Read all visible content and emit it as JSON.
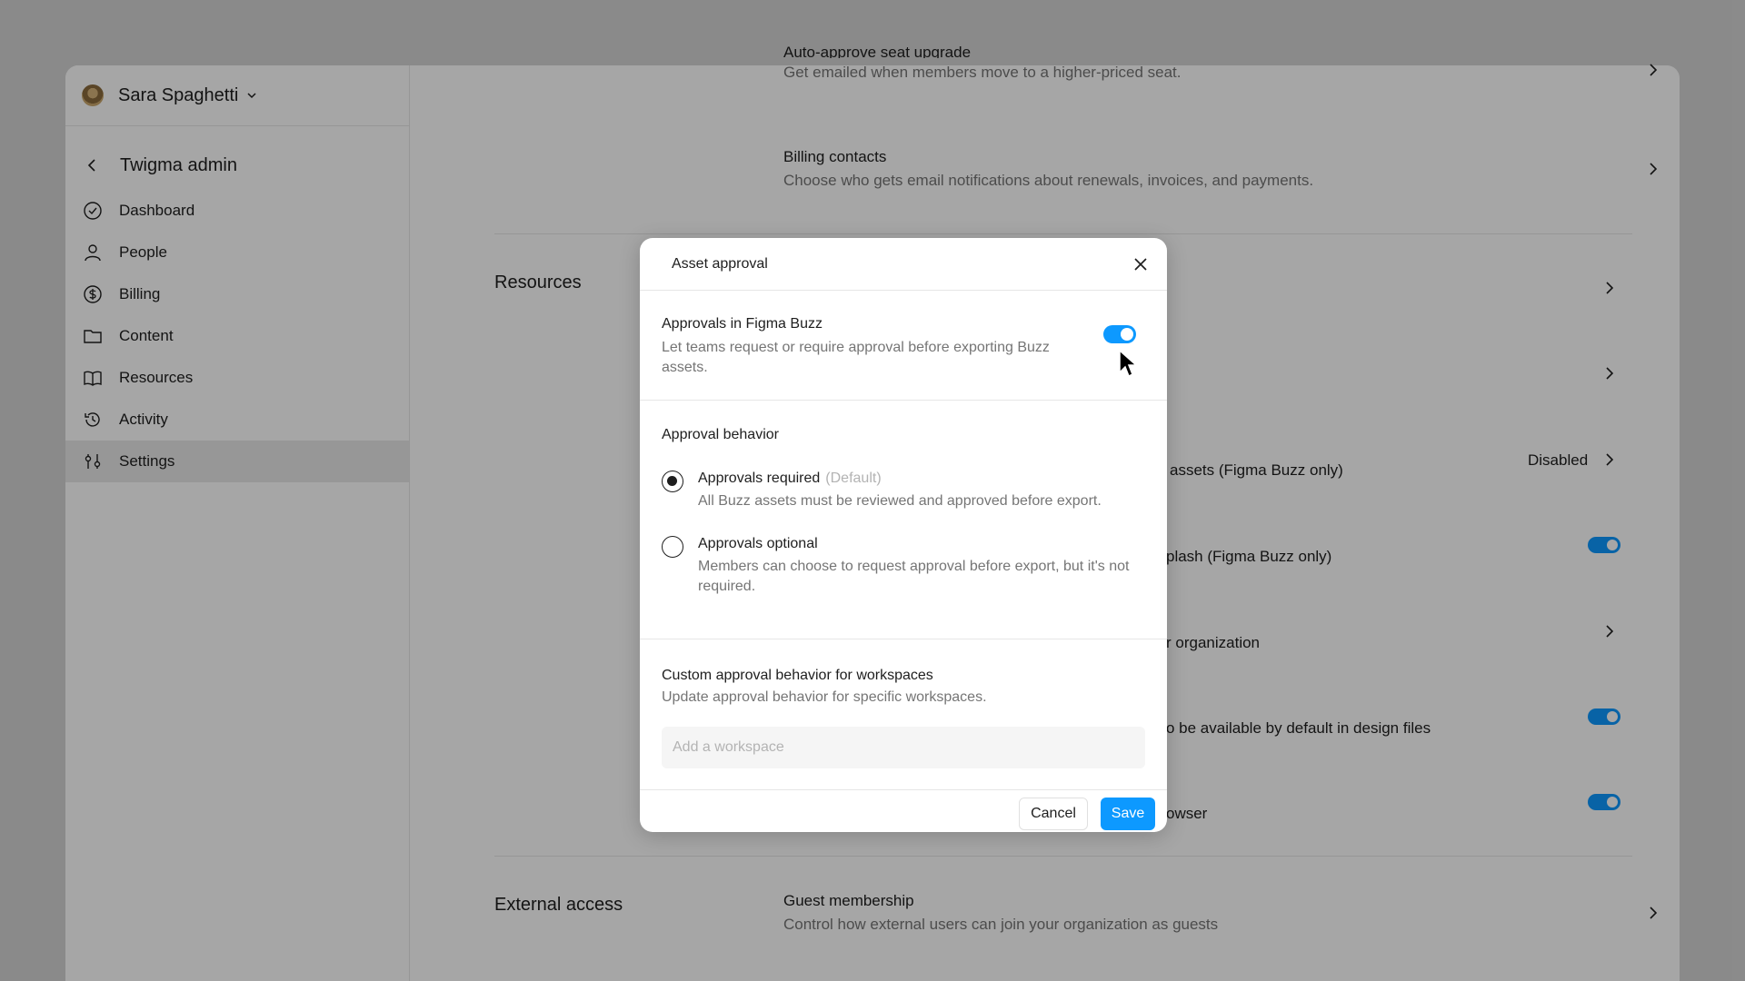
{
  "sidebar": {
    "user_name": "Sara Spaghetti",
    "org_title": "Twigma admin",
    "items": [
      {
        "label": "Dashboard",
        "icon": "check-circle-icon"
      },
      {
        "label": "People",
        "icon": "person-icon"
      },
      {
        "label": "Billing",
        "icon": "dollar-circle-icon"
      },
      {
        "label": "Content",
        "icon": "folder-icon"
      },
      {
        "label": "Resources",
        "icon": "book-icon"
      },
      {
        "label": "Activity",
        "icon": "history-icon"
      },
      {
        "label": "Settings",
        "icon": "sliders-icon",
        "active": true
      }
    ]
  },
  "main": {
    "rows": [
      {
        "title": "Auto-approve seat upgrade",
        "desc": "Get emailed when members move to a higher-priced seat."
      },
      {
        "title": "Billing contacts",
        "desc": "Choose who gets email notifications about renewals, invoices, and payments."
      }
    ],
    "sections": {
      "resources": "Resources",
      "external_access": "External access"
    },
    "resource_fragments": {
      "assets": "assets (Figma Buzz only)",
      "disabled": "Disabled",
      "unsplash": "plash (Figma Buzz only)",
      "organization": "r organization",
      "design_files": "o be available by default in design files",
      "browser": "owser"
    },
    "guest": {
      "title": "Guest membership",
      "desc": "Control how external users can join your organization as guests"
    }
  },
  "modal": {
    "title": "Asset approval",
    "toggle_section": {
      "title": "Approvals in Figma Buzz",
      "desc": "Let teams request or require approval before exporting Buzz assets.",
      "enabled": true
    },
    "behavior": {
      "title": "Approval behavior",
      "options": [
        {
          "label": "Approvals required",
          "tag": "(Default)",
          "desc": "All Buzz assets must be reviewed and approved before export.",
          "selected": true
        },
        {
          "label": "Approvals optional",
          "desc": "Members can choose to request approval before export, but it's not required.",
          "selected": false
        }
      ]
    },
    "custom": {
      "title": "Custom approval behavior for workspaces",
      "desc": "Update approval behavior for specific workspaces.",
      "placeholder": "Add a workspace"
    },
    "buttons": {
      "cancel": "Cancel",
      "save": "Save"
    }
  },
  "colors": {
    "accent": "#0d99ff",
    "overlay": "rgba(0,0,0,0.35)"
  }
}
